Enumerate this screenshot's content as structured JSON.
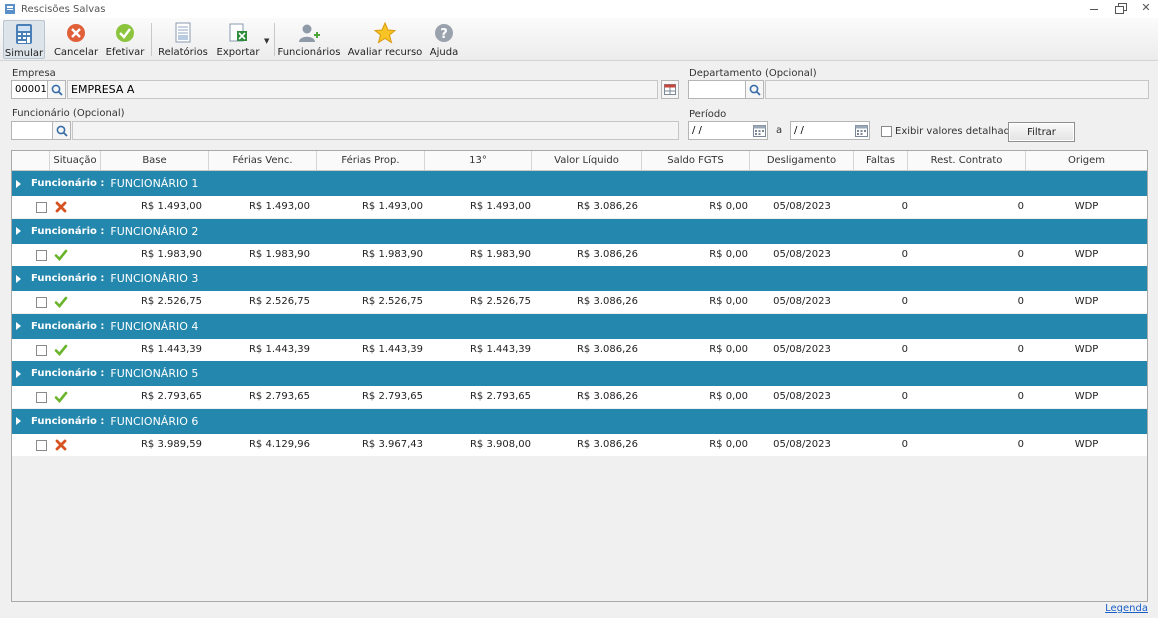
{
  "window": {
    "title": "Rescisões Salvas",
    "close_glyph": "✕"
  },
  "toolbar": {
    "simular": "Simular",
    "cancelar": "Cancelar",
    "efetivar": "Efetivar",
    "relatorios": "Relatórios",
    "exportar": "Exportar",
    "funcionarios": "Funcionários",
    "avaliar": "Avaliar recurso",
    "ajuda": "Ajuda",
    "dropdown_glyph": "▼"
  },
  "form": {
    "empresa_label": "Empresa",
    "empresa_code": "00001",
    "empresa_name": "EMPRESA A",
    "departamento_label": "Departamento (Opcional)",
    "departamento_code": "",
    "departamento_name": "",
    "funcionario_label": "Funcionário (Opcional)",
    "funcionario_code": "",
    "funcionario_name": "",
    "periodo_label": "Período",
    "periodo_de": "/ /",
    "periodo_sep": "a",
    "periodo_ate": "/ /",
    "exibir_label": "Exibir valores detalhados",
    "filtrar_label": "Filtrar"
  },
  "table": {
    "columns": [
      "Situação",
      "Base",
      "Férias Venc.",
      "Férias Prop.",
      "13°",
      "Valor Líquido",
      "Saldo FGTS",
      "Desligamento",
      "Faltas",
      "Rest. Contrato",
      "Origem"
    ],
    "group_label": "Funcionário :",
    "groups": [
      {
        "name": "FUNCIONÁRIO 1",
        "status": "cancelled",
        "base": "R$ 1.493,00",
        "ferias_venc": "R$ 1.493,00",
        "ferias_prop": "R$ 1.493,00",
        "decimo": "R$ 1.493,00",
        "liquido": "R$ 3.086,26",
        "fgts": "R$ 0,00",
        "desligamento": "05/08/2023",
        "faltas": "0",
        "rest": "0",
        "origem": "WDP"
      },
      {
        "name": "FUNCIONÁRIO 2",
        "status": "ok",
        "base": "R$ 1.983,90",
        "ferias_venc": "R$ 1.983,90",
        "ferias_prop": "R$ 1.983,90",
        "decimo": "R$ 1.983,90",
        "liquido": "R$ 3.086,26",
        "fgts": "R$ 0,00",
        "desligamento": "05/08/2023",
        "faltas": "0",
        "rest": "0",
        "origem": "WDP"
      },
      {
        "name": "FUNCIONÁRIO 3",
        "status": "ok",
        "base": "R$ 2.526,75",
        "ferias_venc": "R$ 2.526,75",
        "ferias_prop": "R$ 2.526,75",
        "decimo": "R$ 2.526,75",
        "liquido": "R$ 3.086,26",
        "fgts": "R$ 0,00",
        "desligamento": "05/08/2023",
        "faltas": "0",
        "rest": "0",
        "origem": "WDP"
      },
      {
        "name": "FUNCIONÁRIO 4",
        "status": "ok",
        "base": "R$ 1.443,39",
        "ferias_venc": "R$ 1.443,39",
        "ferias_prop": "R$ 1.443,39",
        "decimo": "R$ 1.443,39",
        "liquido": "R$ 3.086,26",
        "fgts": "R$ 0,00",
        "desligamento": "05/08/2023",
        "faltas": "0",
        "rest": "0",
        "origem": "WDP"
      },
      {
        "name": "FUNCIONÁRIO 5",
        "status": "ok",
        "base": "R$ 2.793,65",
        "ferias_venc": "R$ 2.793,65",
        "ferias_prop": "R$ 2.793,65",
        "decimo": "R$ 2.793,65",
        "liquido": "R$ 3.086,26",
        "fgts": "R$ 0,00",
        "desligamento": "05/08/2023",
        "faltas": "0",
        "rest": "0",
        "origem": "WDP"
      },
      {
        "name": "FUNCIONÁRIO 6",
        "status": "cancelled",
        "base": "R$ 3.989,59",
        "ferias_venc": "R$ 4.129,96",
        "ferias_prop": "R$ 3.967,43",
        "decimo": "R$ 3.908,00",
        "liquido": "R$ 3.086,26",
        "fgts": "R$ 0,00",
        "desligamento": "05/08/2023",
        "faltas": "0",
        "rest": "0",
        "origem": "WDP"
      }
    ]
  },
  "footer": {
    "legenda": "Legenda"
  },
  "colors": {
    "group_bg": "#2487ad",
    "ok": "#6ab42c",
    "cancel": "#d6521f",
    "link": "#1a5fc6"
  }
}
